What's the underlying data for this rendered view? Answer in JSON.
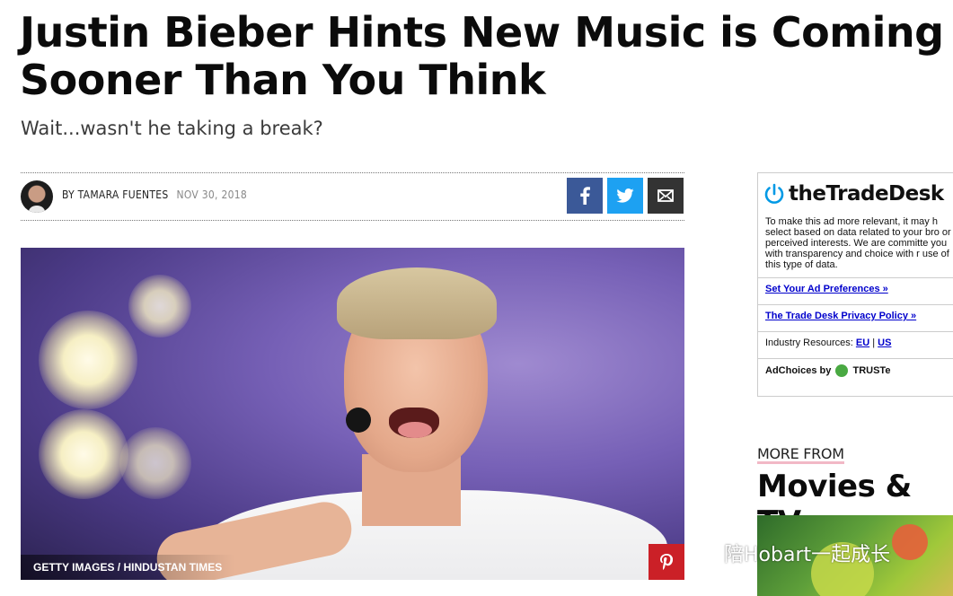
{
  "article": {
    "headline": "Justin Bieber Hints New Music is Coming Sooner Than You Think",
    "dek": "Wait...wasn't he taking a break?",
    "byline": "BY TAMARA FUENTES",
    "date": "NOV 30, 2018",
    "image_credit": "GETTY IMAGES / HINDUSTAN TIMES"
  },
  "share": {
    "facebook_icon": "facebook-icon",
    "twitter_icon": "twitter-icon",
    "email_icon": "envelope-icon",
    "pinterest_icon": "pinterest-icon",
    "colors": {
      "facebook": "#3b5998",
      "twitter": "#1da1f2",
      "email": "#333333",
      "pinterest": "#cb2027"
    }
  },
  "ad": {
    "brand": "theTradeDesk",
    "body": "To make this ad more relevant, it may h select based on data related to your bro or perceived interests. We are committe you with transparency and choice with r use of this type of data.",
    "set_prefs": "Set Your Ad Preferences »",
    "privacy": "The Trade Desk Privacy Policy »",
    "industry_label": "Industry Resources:",
    "eu": "EU",
    "sep": "|",
    "us": "US",
    "adchoices": "AdChoices by",
    "truste": "TRUSTe"
  },
  "sidebar": {
    "more_from": "MORE FROM",
    "section": "Movies & TV"
  },
  "watermark": {
    "text": "陪Hobart一起成长"
  }
}
